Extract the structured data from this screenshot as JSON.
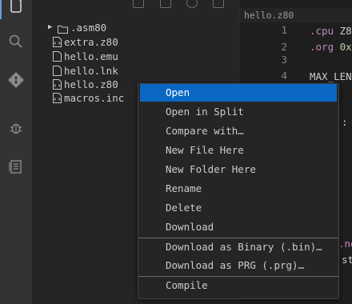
{
  "activity_bar": {
    "icons": [
      "files-icon",
      "search-icon",
      "source-control-icon",
      "debug-icon",
      "extensions-icon"
    ]
  },
  "explorer": {
    "items": [
      {
        "label": ".asm80",
        "type": "folder",
        "collapsed": true
      },
      {
        "label": "extra.z80",
        "type": "file-code"
      },
      {
        "label": "hello.emu",
        "type": "file"
      },
      {
        "label": "hello.lnk",
        "type": "file"
      },
      {
        "label": "hello.z80",
        "type": "file-code"
      },
      {
        "label": "macros.inc",
        "type": "file-code"
      }
    ]
  },
  "editor": {
    "tab_label": "hello.z80",
    "line_numbers": [
      "1",
      "2",
      "3",
      "4"
    ],
    "lines": [
      {
        "kw": ".cpu",
        "rest": " Z8"
      },
      {
        "kw": ".org",
        "rest": " 0x"
      },
      {
        "kw": "",
        "rest": ""
      },
      {
        "kw": "",
        "rest": "MAX_LEN"
      }
    ],
    "peek_colon": ":",
    "peek_ne": ".ne",
    "peek_st": "st"
  },
  "context_menu": {
    "items": [
      "Open",
      "Open in Split",
      "Compare with…",
      "New File Here",
      "New Folder Here",
      "Rename",
      "Delete",
      "Download",
      "Download as Binary (.bin)…",
      "Download as PRG (.prg)…",
      "Compile"
    ],
    "selected": "Open"
  },
  "colors": {
    "accent": "#0a68c4",
    "keyword": "#c586c0",
    "number": "#b5cea8"
  }
}
